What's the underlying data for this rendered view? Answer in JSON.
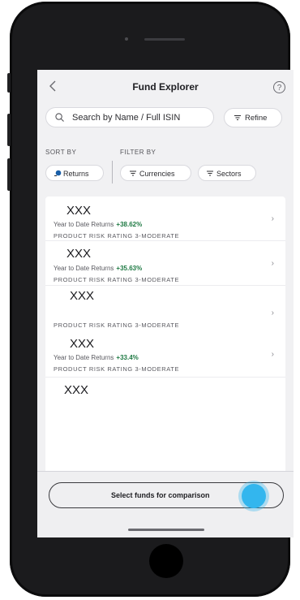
{
  "header": {
    "title": "Fund Explorer",
    "back_icon": "chevron-left-icon",
    "help_icon": "question-circle-icon"
  },
  "search": {
    "placeholder": "Search by Name / Full ISIN",
    "value": "",
    "icon": "search-icon"
  },
  "refine": {
    "label": "Refine",
    "icon": "filter-lines-icon"
  },
  "sort": {
    "label": "SORT BY",
    "chip": {
      "label": "Returns",
      "icon": "sort-returns-icon"
    }
  },
  "filter": {
    "label": "FILTER BY",
    "chips": [
      {
        "label": "Currencies",
        "icon": "filter-lines-icon"
      },
      {
        "label": "Sectors",
        "icon": "filter-lines-icon"
      }
    ]
  },
  "funds": [
    {
      "name": "XXX",
      "returns_label": "Year to Date Returns",
      "returns_value": "+38.62%",
      "risk": "PRODUCT RISK RATING 3-MODERATE"
    },
    {
      "name": "XXX",
      "returns_label": "Year to Date Returns",
      "returns_value": "+35.63%",
      "risk": "PRODUCT RISK RATING 3-MODERATE"
    },
    {
      "name": "XXX",
      "returns_label": "",
      "returns_value": "",
      "risk": "PRODUCT RISK RATING 3-MODERATE"
    },
    {
      "name": "XXX",
      "returns_label": "Year to Date Returns",
      "returns_value": "+33.4%",
      "risk": "PRODUCT RISK RATING 3-MODERATE"
    },
    {
      "name": "XXX",
      "returns_label": "",
      "returns_value": "",
      "risk": ""
    }
  ],
  "compare": {
    "label": "Select funds for comparison"
  },
  "colors": {
    "positive": "#1f7a44",
    "touch": "#33b6ee",
    "background": "#f1f1f3"
  }
}
